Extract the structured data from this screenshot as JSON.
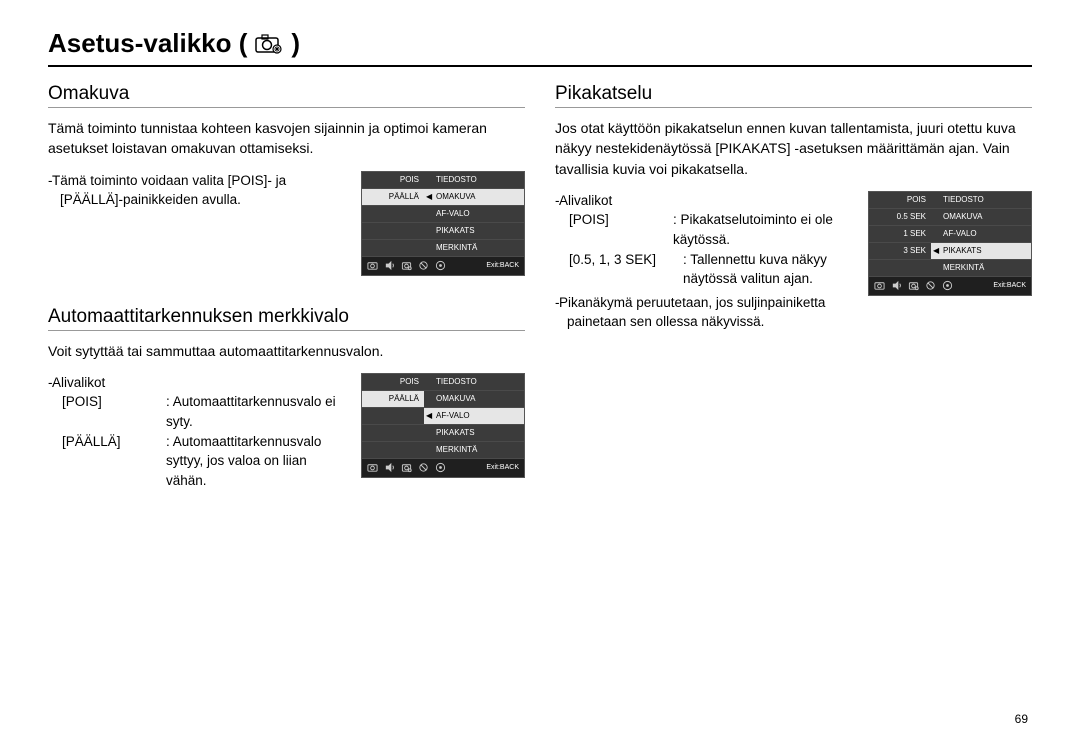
{
  "page_title": "Asetus-valikko  (",
  "page_title_close": ")",
  "page_number": "69",
  "left": {
    "sec1": {
      "title": "Omakuva",
      "body": "Tämä toiminto tunnistaa kohteen kasvojen sijainnin ja optimoi kameran asetukset loistavan omakuvan ottamiseksi.",
      "note": "Tämä toiminto voidaan valita [POIS]- ja [PÄÄLLÄ]-painikkeiden avulla.",
      "lcd": {
        "leftItems": [
          "POIS",
          "PÄÄLLÄ",
          "",
          "",
          ""
        ],
        "selectedLeft": 1,
        "rightItems": [
          "TIEDOSTO",
          "OMAKUVA",
          "AF-VALO",
          "PIKAKATS",
          "MERKINTÄ"
        ],
        "selectedRight": 1,
        "exit": "Exit:BACK"
      }
    },
    "sec2": {
      "title": "Automaattitarkennuksen merkkivalo",
      "body": "Voit sytyttää tai sammuttaa automaattitarkennusvalon.",
      "sub_label": "Alivalikot",
      "rows": [
        {
          "key": "[POIS]",
          "val": ": Automaattitarkennusvalo ei syty."
        },
        {
          "key": "[PÄÄLLÄ]",
          "val": ": Automaattitarkennusvalo syttyy, jos valoa on liian vähän."
        }
      ],
      "lcd": {
        "leftItems": [
          "POIS",
          "PÄÄLLÄ",
          "",
          "",
          ""
        ],
        "selectedLeft": 1,
        "rightItems": [
          "TIEDOSTO",
          "OMAKUVA",
          "AF-VALO",
          "PIKAKATS",
          "MERKINTÄ"
        ],
        "selectedRight": 2,
        "exit": "Exit:BACK"
      }
    }
  },
  "right": {
    "sec1": {
      "title": "Pikakatselu",
      "body": "Jos otat käyttöön pikakatselun ennen kuvan tallentamista, juuri otettu kuva näkyy nestekidenäytössä [PIKAKATS] -asetuksen määrittämän ajan. Vain tavallisia kuvia voi pikakatsella.",
      "sub_label": "Alivalikot",
      "rows": [
        {
          "key": "[POIS]",
          "val": ": Pikakatselutoiminto ei ole käytössä."
        },
        {
          "key": "[0.5, 1, 3 SEK]",
          "val": ": Tallennettu kuva näkyy näytössä valitun ajan."
        }
      ],
      "note": "Pikanäkymä peruutetaan, jos suljinpainiketta painetaan sen ollessa näkyvissä.",
      "lcd": {
        "leftItems": [
          "POIS",
          "0.5 SEK",
          "1 SEK",
          "3 SEK",
          ""
        ],
        "selectedLeft": -1,
        "rightItems": [
          "TIEDOSTO",
          "OMAKUVA",
          "AF-VALO",
          "PIKAKATS",
          "MERKINTÄ"
        ],
        "selectedRight": 3,
        "exit": "Exit:BACK"
      }
    }
  }
}
